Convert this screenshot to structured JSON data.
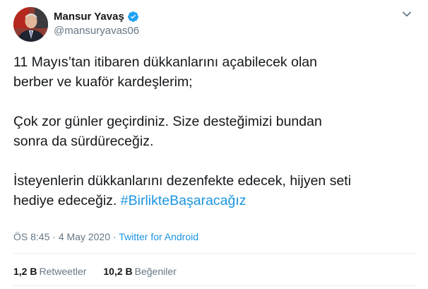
{
  "author": {
    "display_name": "Mansur Yavaş",
    "handle": "@mansuryavas06",
    "verified": true
  },
  "tweet": {
    "line1": "11 Mayıs’tan itibaren dükkanlarını açabilecek olan",
    "line2": "berber ve kuaför kardeşlerim;",
    "line3": "Çok zor günler geçirdiniz. Size desteğimizi bundan",
    "line4": "sonra da sürdüreceğiz.",
    "line5": "İsteyenlerin dükkanlarını dezenfekte edecek, hijyen seti",
    "line6_prefix": "hediye edeceğiz. ",
    "hashtag": "#BirlikteBaşaracağız"
  },
  "meta": {
    "time": "ÖS 8:45",
    "separator1": " · ",
    "date": "4 May 2020",
    "separator2": " · ",
    "source": "Twitter for Android"
  },
  "stats": {
    "retweets_count": "1,2 B",
    "retweets_label": "Retweetler",
    "likes_count": "10,2 B",
    "likes_label": "Beğeniler"
  },
  "colors": {
    "link": "#1b95e0",
    "secondary": "#657786",
    "verified": "#1da1f2"
  }
}
